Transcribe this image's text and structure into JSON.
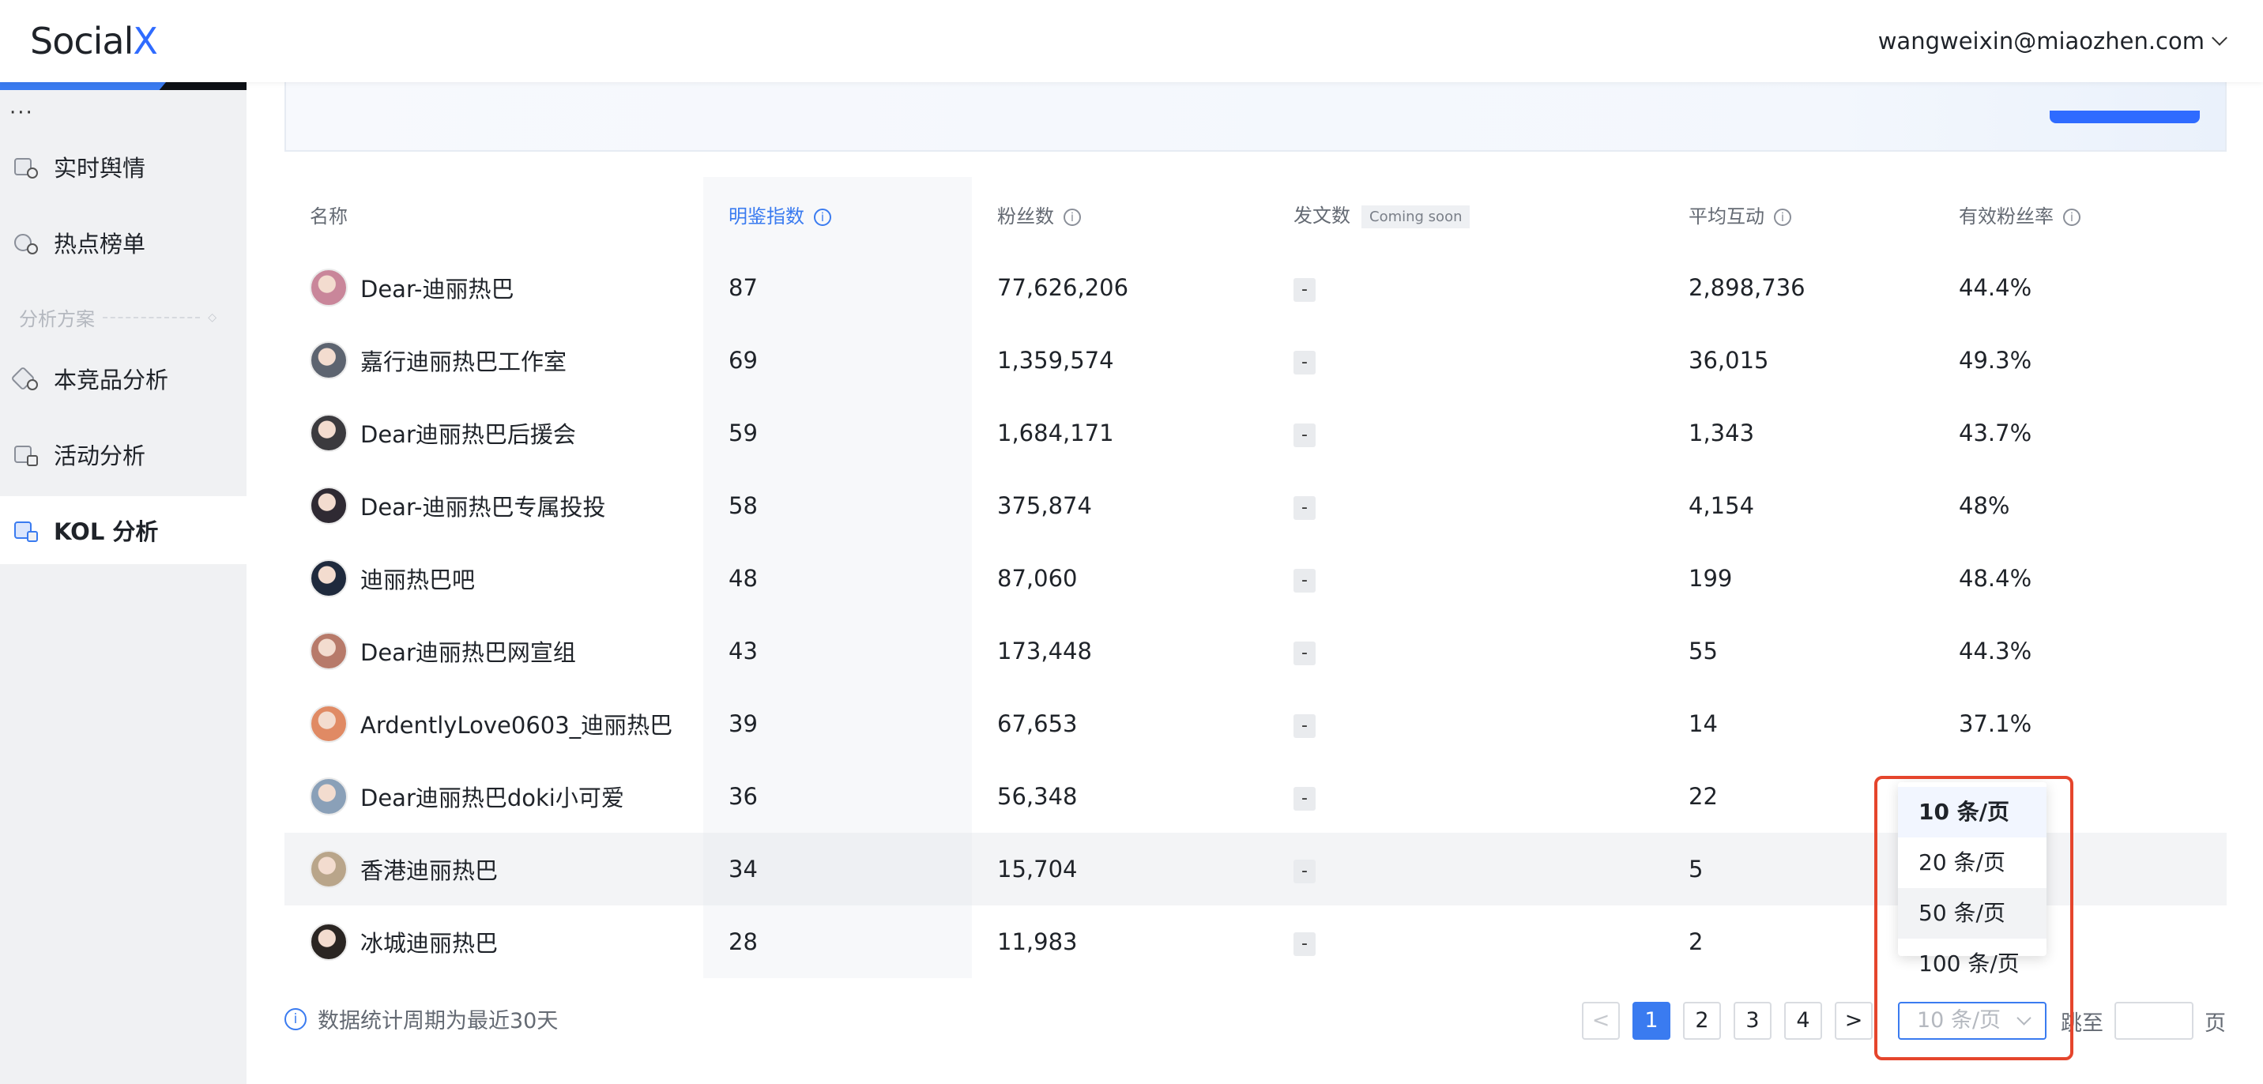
{
  "header": {
    "logo_main": "Social",
    "logo_accent": "X",
    "user_email": "wangweixin@miaozhen.com"
  },
  "sidebar": {
    "more": "···",
    "items": [
      {
        "label": "实时舆情",
        "icon": "public-opinion-icon"
      },
      {
        "label": "热点榜单",
        "icon": "hot-list-icon"
      },
      {
        "label": "本竞品分析",
        "icon": "competitor-analysis-icon"
      },
      {
        "label": "活动分析",
        "icon": "campaign-analysis-icon"
      },
      {
        "label": "KOL 分析",
        "icon": "kol-analysis-icon",
        "active": true
      }
    ],
    "section_label": "分析方案"
  },
  "table": {
    "columns": {
      "name": "名称",
      "index": "明鉴指数",
      "fans": "粉丝数",
      "posts": "发文数",
      "posts_badge": "Coming soon",
      "engagement": "平均互动",
      "valid_rate": "有效粉丝率"
    },
    "rows": [
      {
        "name": "Dear-迪丽热巴",
        "index": "87",
        "fans": "77,626,206",
        "posts": "-",
        "engagement": "2,898,736",
        "valid_rate": "44.4%",
        "avatar_color": "#c9869a"
      },
      {
        "name": "嘉行迪丽热巴工作室",
        "index": "69",
        "fans": "1,359,574",
        "posts": "-",
        "engagement": "36,015",
        "valid_rate": "49.3%",
        "avatar_color": "#5d6470"
      },
      {
        "name": "Dear迪丽热巴后援会",
        "index": "59",
        "fans": "1,684,171",
        "posts": "-",
        "engagement": "1,343",
        "valid_rate": "43.7%",
        "avatar_color": "#3b3a3e"
      },
      {
        "name": "Dear-迪丽热巴专属投投",
        "index": "58",
        "fans": "375,874",
        "posts": "-",
        "engagement": "4,154",
        "valid_rate": "48%",
        "avatar_color": "#2f2a33"
      },
      {
        "name": "迪丽热巴吧",
        "index": "48",
        "fans": "87,060",
        "posts": "-",
        "engagement": "199",
        "valid_rate": "48.4%",
        "avatar_color": "#1f2a3d"
      },
      {
        "name": "Dear迪丽热巴网宣组",
        "index": "43",
        "fans": "173,448",
        "posts": "-",
        "engagement": "55",
        "valid_rate": "44.3%",
        "avatar_color": "#b77a6a"
      },
      {
        "name": "ArdentlyLove0603_迪丽热巴",
        "index": "39",
        "fans": "67,653",
        "posts": "-",
        "engagement": "14",
        "valid_rate": "37.1%",
        "avatar_color": "#e08a64"
      },
      {
        "name": "Dear迪丽热巴doki小可爱",
        "index": "36",
        "fans": "56,348",
        "posts": "-",
        "engagement": "22",
        "valid_rate": "",
        "avatar_color": "#8aa0b8"
      },
      {
        "name": "香港迪丽热巴",
        "index": "34",
        "fans": "15,704",
        "posts": "-",
        "engagement": "5",
        "valid_rate": "",
        "avatar_color": "#b9a58a"
      },
      {
        "name": "冰城迪丽热巴",
        "index": "28",
        "fans": "11,983",
        "posts": "-",
        "engagement": "2",
        "valid_rate": "",
        "avatar_color": "#2a2522"
      }
    ]
  },
  "footer": {
    "note": "数据统计周期为最近30天",
    "pages": [
      "1",
      "2",
      "3",
      "4"
    ],
    "current_page": "1",
    "prev": "<",
    "next": ">",
    "page_size_value": "10 条/页",
    "jump_label": "跳至",
    "page_suffix": "页"
  },
  "page_size_dropdown": {
    "options": [
      "10 条/页",
      "20 条/页",
      "50 条/页",
      "100 条/页"
    ],
    "selected_index": 0,
    "hovered_index": 2
  },
  "colors": {
    "accent": "#3a7bf0",
    "highlight_annotation": "#e5452c"
  }
}
